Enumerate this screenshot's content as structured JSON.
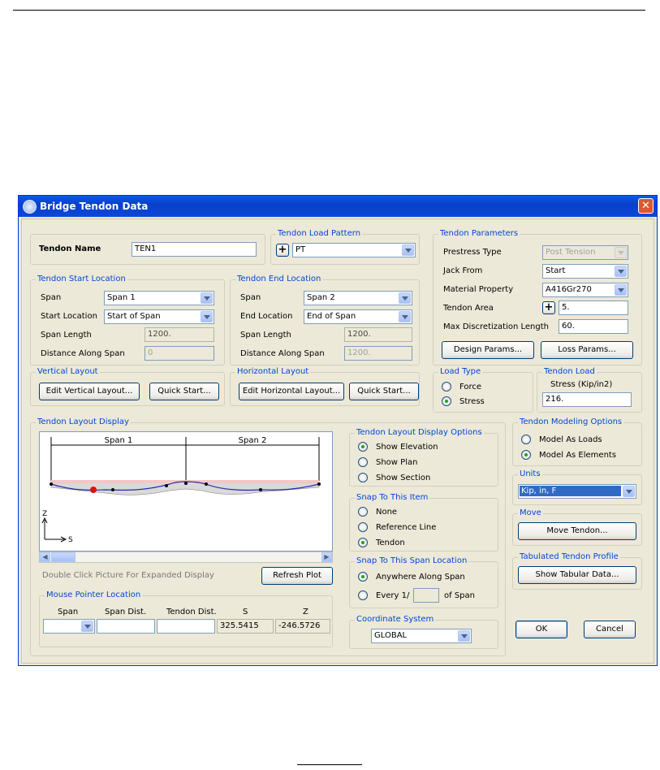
{
  "title": "Bridge Tendon Data",
  "tendon_name": {
    "label": "Tendon Name",
    "value": "TEN1"
  },
  "load_pattern": {
    "group": "Tendon Load Pattern",
    "value": "PT"
  },
  "params": {
    "group": "Tendon Parameters",
    "prestress_type": {
      "label": "Prestress Type",
      "value": "Post Tension"
    },
    "jack_from": {
      "label": "Jack From",
      "value": "Start"
    },
    "material": {
      "label": "Material Property",
      "value": "A416Gr270"
    },
    "area": {
      "label": "Tendon Area",
      "value": "5."
    },
    "max_disc": {
      "label": "Max Discretization Length",
      "value": "60."
    },
    "design_btn": "Design Params...",
    "loss_btn": "Loss Params..."
  },
  "start_loc": {
    "group": "Tendon Start Location",
    "span_label": "Span",
    "span_value": "Span 1",
    "loc_label": "Start Location",
    "loc_value": "Start of Span",
    "length_label": "Span Length",
    "length_value": "1200.",
    "dist_label": "Distance Along Span",
    "dist_value": "0"
  },
  "end_loc": {
    "group": "Tendon End Location",
    "span_label": "Span",
    "span_value": "Span 2",
    "loc_label": "End Location",
    "loc_value": "End of Span",
    "length_label": "Span Length",
    "length_value": "1200.",
    "dist_label": "Distance Along Span",
    "dist_value": "1200."
  },
  "vertical": {
    "group": "Vertical Layout",
    "edit_btn": "Edit Vertical Layout...",
    "quick_btn": "Quick Start..."
  },
  "horizontal": {
    "group": "Horizontal Layout",
    "edit_btn": "Edit Horizontal Layout...",
    "quick_btn": "Quick Start..."
  },
  "load_type": {
    "group": "Load Type",
    "force": "Force",
    "stress": "Stress",
    "selected": "stress"
  },
  "tendon_load": {
    "group": "Tendon Load",
    "label": "Stress  (Kip/in2)",
    "value": "216."
  },
  "display": {
    "group": "Tendon Layout Display",
    "span1": "Span 1",
    "span2": "Span 2",
    "axis_z": "Z",
    "axis_s": "S",
    "hint": "Double Click Picture For Expanded Display",
    "refresh_btn": "Refresh Plot"
  },
  "display_options": {
    "group": "Tendon Layout Display Options",
    "elevation": "Show Elevation",
    "plan": "Show Plan",
    "section": "Show Section",
    "selected": "elevation"
  },
  "snap_item": {
    "group": "Snap To This Item",
    "none": "None",
    "refline": "Reference Line",
    "tendon": "Tendon",
    "selected": "tendon"
  },
  "snap_span": {
    "group": "Snap To This Span Location",
    "anywhere": "Anywhere Along Span",
    "every": "Every 1/",
    "of_span": "of Span",
    "every_value": "",
    "selected": "anywhere"
  },
  "coord": {
    "group": "Coordinate System",
    "value": "GLOBAL"
  },
  "mouse": {
    "group": "Mouse Pointer Location",
    "col_span": "Span",
    "col_span_dist": "Span Dist.",
    "col_tendon_dist": "Tendon Dist.",
    "col_s": "S",
    "col_z": "Z",
    "span_value": "",
    "span_dist_value": "",
    "tendon_dist_value": "",
    "s_value": "325.5415",
    "z_value": "-246.5726"
  },
  "modeling": {
    "group": "Tendon Modeling Options",
    "loads": "Model  As Loads",
    "elements": "Model  As Elements",
    "selected": "elements"
  },
  "units": {
    "group": "Units",
    "value": "Kip, in, F"
  },
  "move": {
    "group": "Move",
    "btn": "Move Tendon..."
  },
  "tabulated": {
    "group": "Tabulated Tendon Profile",
    "btn": "Show Tabular Data..."
  },
  "ok_btn": "OK",
  "cancel_btn": "Cancel",
  "colors": {
    "titlebar": "#0a48d8",
    "group_label": "#0046d5",
    "selection": "#316ac5",
    "tendon_line": "#1f2fa8",
    "marker": "#e01010"
  }
}
